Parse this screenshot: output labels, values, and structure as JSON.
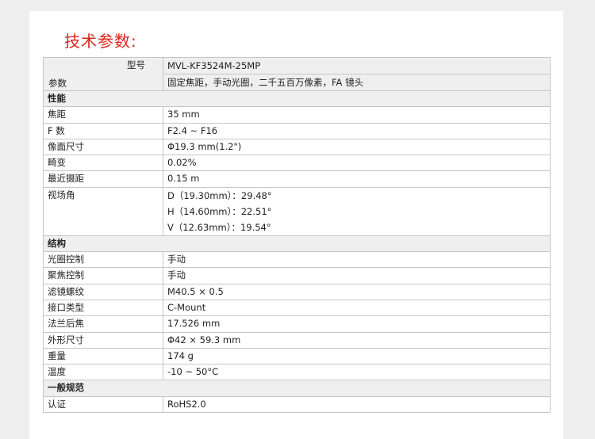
{
  "title": "技术参数:",
  "header": {
    "model_label": "型号",
    "param_label": "参数",
    "model_value": "MVL-KF3524M-25MP",
    "desc_value": "固定焦距，手动光圈，二千五百万像素，FA 镜头"
  },
  "sections": {
    "performance": "性能",
    "structure": "结构",
    "general": "一般规范"
  },
  "performance": {
    "focal_label": "焦距",
    "focal_value": "35 mm",
    "fnum_label": "F 数",
    "fnum_value": "F2.4 ~ F16",
    "image_label": "像面尺寸",
    "image_value": "Φ19.3 mm(1.2\")",
    "distortion_label": "畸变",
    "distortion_value": "0.02%",
    "mod_label": "最近摄距",
    "mod_value": "0.15 m",
    "fov_label": "视场角",
    "fov": [
      "D（19.30mm）：29.48°",
      "H（14.60mm）：22.51°",
      "V（12.63mm）：19.54°"
    ]
  },
  "structure": {
    "iris_label": "光圈控制",
    "iris_value": "手动",
    "focus_label": "聚焦控制",
    "focus_value": "手动",
    "filter_label": "滤镜螺纹",
    "filter_value": "M40.5 × 0.5",
    "mount_label": "接口类型",
    "mount_value": "C-Mount",
    "flange_label": "法兰后焦",
    "flange_value": "17.526 mm",
    "dim_label": "外形尺寸",
    "dim_value": "Φ42 × 59.3 mm",
    "weight_label": "重量",
    "weight_value": "174 g",
    "temp_label": "温度",
    "temp_value": "-10 ~ 50°C"
  },
  "general": {
    "cert_label": "认证",
    "cert_value": "RoHS2.0"
  }
}
